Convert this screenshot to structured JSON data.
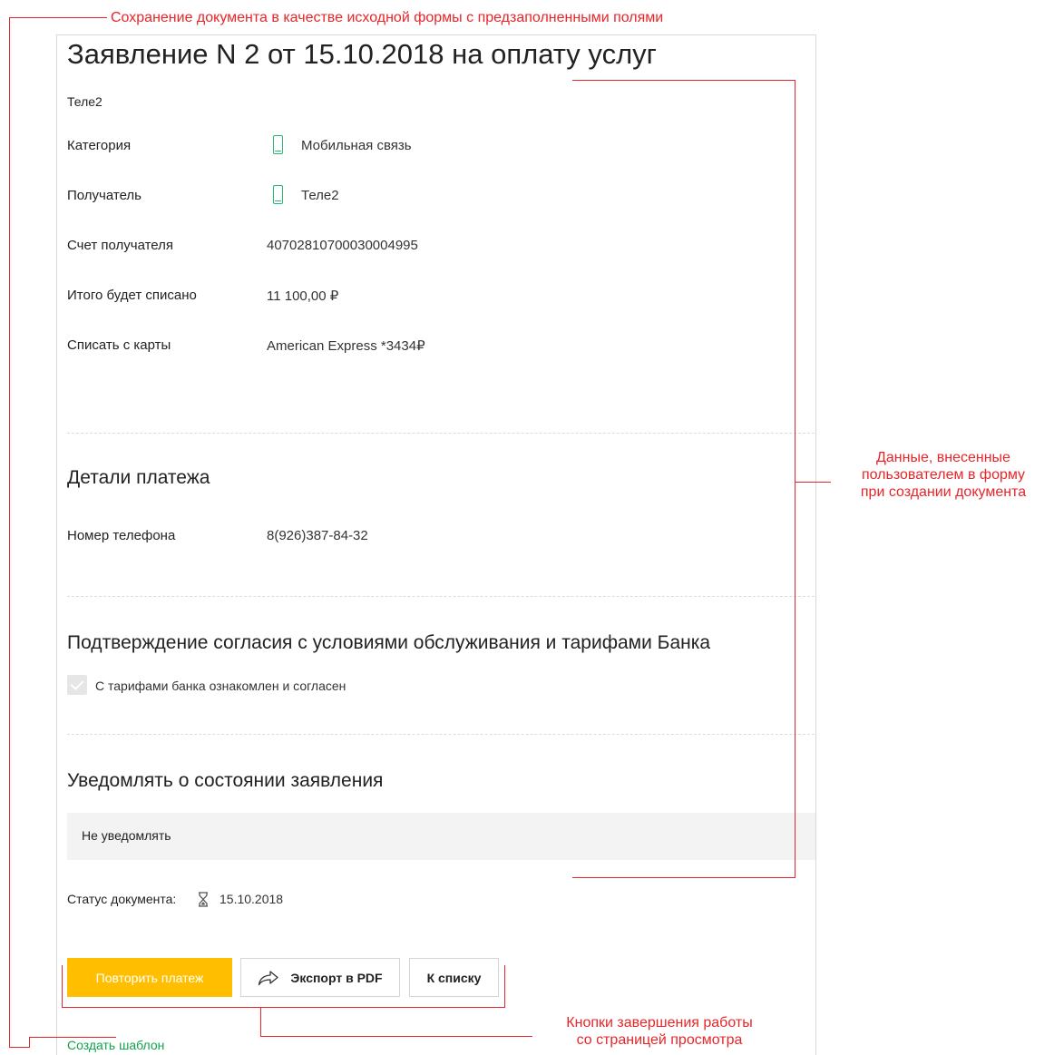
{
  "annotations": {
    "top": "Сохранение документа в качестве исходной формы с предзаполненными полями",
    "right": [
      "Данные, внесенные",
      "пользователем в форму",
      "при создании  документа"
    ],
    "bottom": [
      "Кнопки завершения работы",
      "со страницей просмотра"
    ]
  },
  "document": {
    "title": "Заявление N 2 от 15.10.2018 на оплату услуг",
    "provider": "Теле2",
    "fields": [
      {
        "label": "Категория",
        "value": "Мобильная связь",
        "icon": "mobile-phone-icon"
      },
      {
        "label": "Получатель",
        "value": "Теле2",
        "icon": "mobile-phone-icon"
      },
      {
        "label": "Счет получателя",
        "value": "40702810700030004995"
      },
      {
        "label": "Итого будет списано",
        "value": "11 100,00 ₽"
      },
      {
        "label": "Списать с карты",
        "value": "American Express *3434₽"
      }
    ],
    "payment_details": {
      "title": "Детали платежа",
      "phone_label": "Номер телефона",
      "phone_value": "8(926)387-84-32"
    },
    "consent": {
      "title": "Подтверждение согласия с условиями обслуживания и тарифами Банка",
      "checkbox_label": "С тарифами банка ознакомлен и согласен",
      "checked": true
    },
    "notify": {
      "title": "Уведомлять о состоянии заявления",
      "value": "Не уведомлять"
    },
    "status": {
      "label": "Статус документа:",
      "icon": "hourglass-icon",
      "date": "15.10.2018"
    }
  },
  "buttons": {
    "repeat": "Повторить платеж",
    "export": "Экспорт в PDF",
    "to_list": "К списку"
  },
  "create_template": "Создать шаблон",
  "colors": {
    "accent_yellow": "#ffbf00",
    "annotation_red": "#e8262a",
    "link_green": "#11a34e",
    "icon_green": "#2bb673"
  }
}
